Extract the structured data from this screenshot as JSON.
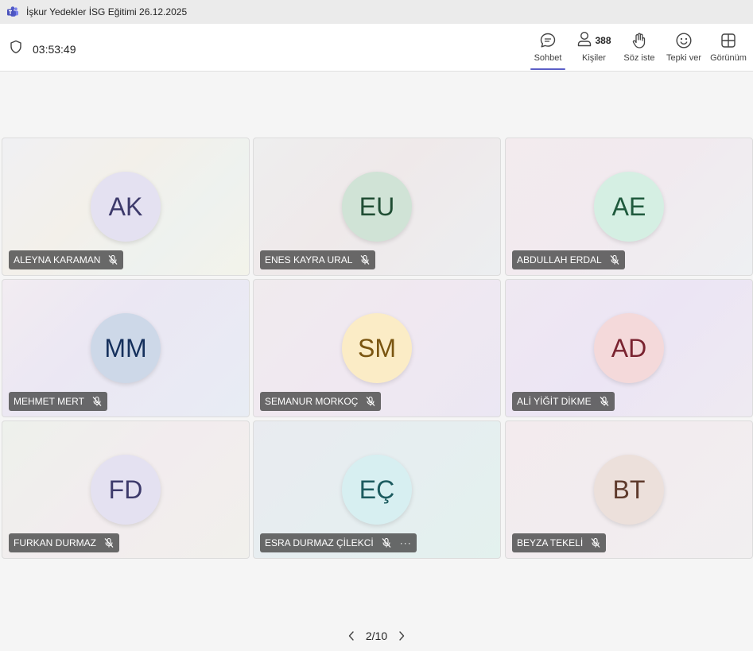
{
  "window": {
    "title": "İşkur Yedekler İSG Eğitimi 26.12.2025",
    "app_icon": "teams-icon"
  },
  "toolbar": {
    "timer": "03:53:49",
    "buttons": [
      {
        "id": "chat",
        "label": "Sohbet",
        "icon": "chat-icon",
        "active": true
      },
      {
        "id": "people",
        "label": "Kişiler",
        "icon": "people-icon",
        "count": "388"
      },
      {
        "id": "raise-hand",
        "label": "Söz iste",
        "icon": "hand-icon"
      },
      {
        "id": "react",
        "label": "Tepki ver",
        "icon": "smiley-icon"
      },
      {
        "id": "view",
        "label": "Görünüm",
        "icon": "grid-view-icon"
      }
    ]
  },
  "participants": [
    {
      "initials": "AK",
      "name": "ALEYNA KARAMAN",
      "muted": true,
      "avatar_bg": "#e4e1f1",
      "avatar_fg": "#3d3a6b"
    },
    {
      "initials": "EU",
      "name": "ENES KAYRA URAL",
      "muted": true,
      "avatar_bg": "#d0e3d6",
      "avatar_fg": "#1f4d33"
    },
    {
      "initials": "AE",
      "name": "ABDULLAH ERDAL",
      "muted": true,
      "avatar_bg": "#d5efe3",
      "avatar_fg": "#1f5a3d"
    },
    {
      "initials": "MM",
      "name": "MEHMET MERT",
      "muted": true,
      "avatar_bg": "#cdd8e8",
      "avatar_fg": "#15305c"
    },
    {
      "initials": "SM",
      "name": "SEMANUR MORKOÇ",
      "muted": true,
      "avatar_bg": "#fbecc6",
      "avatar_fg": "#7a5510"
    },
    {
      "initials": "AD",
      "name": "ALİ YİĞİT DİKME",
      "muted": true,
      "avatar_bg": "#f4d9da",
      "avatar_fg": "#7a2330"
    },
    {
      "initials": "FD",
      "name": "FURKAN DURMAZ",
      "muted": true,
      "avatar_bg": "#e4e1f1",
      "avatar_fg": "#3d3a6b"
    },
    {
      "initials": "EÇ",
      "name": "ESRA DURMAZ ÇİLEKCİ",
      "muted": true,
      "more": "···",
      "avatar_bg": "#d7eff1",
      "avatar_fg": "#1c5b5f"
    },
    {
      "initials": "BT",
      "name": "BEYZA TEKELİ",
      "muted": true,
      "avatar_bg": "#ece0db",
      "avatar_fg": "#5e3a2c"
    }
  ],
  "pager": {
    "label": "2/10"
  }
}
